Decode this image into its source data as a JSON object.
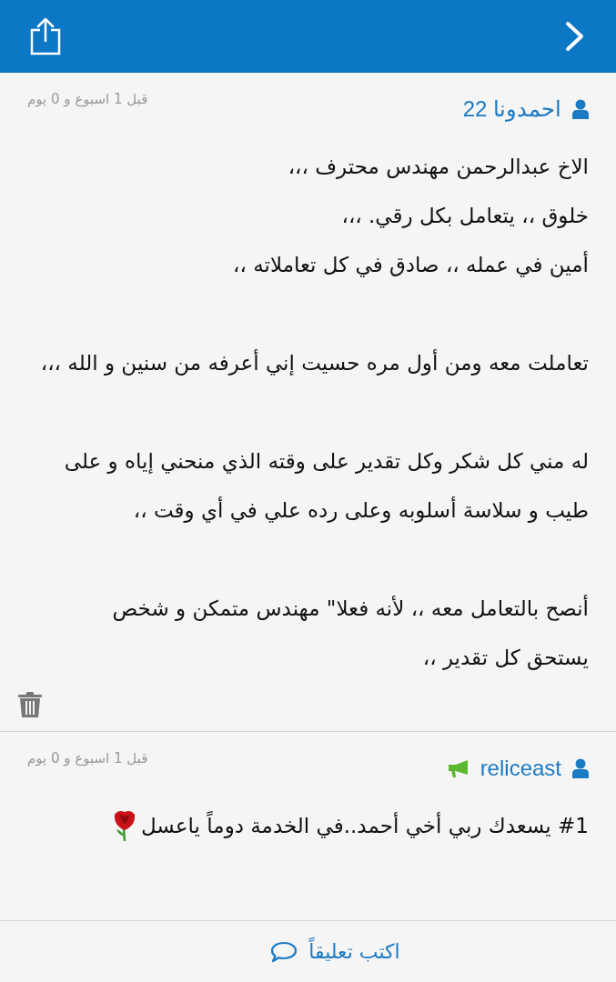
{
  "comments": [
    {
      "author": "احمدونا 22",
      "advertiser": false,
      "time": "قبل 1 اسبوع و 0 يوم",
      "deletable": true,
      "rose": false,
      "paragraphs": [
        [
          "الاخ عبدالرحمن مهندس محترف ،،،",
          "خلوق ،، يتعامل بكل رقي. ،،،",
          "أمين في عمله ،، صادق في كل تعاملاته ،،"
        ],
        [
          "تعاملت معه ومن أول مره حسيت إني أعرفه من سنين و الله ،،،"
        ],
        [
          "له مني كل شكر وكل تقدير على وقته الذي منحني إياه و على",
          "طيب و سلاسة أسلوبه وعلى رده علي في أي وقت ،،"
        ],
        [
          "أنصح بالتعامل معه ،، لأنه فعلا\" مهندس متمكن و شخص",
          "يستحق كل تقدير ،،"
        ]
      ]
    },
    {
      "author": "reliceast",
      "advertiser": true,
      "time": "قبل 1 اسبوع و 0 يوم",
      "deletable": false,
      "rose": true,
      "paragraphs": [
        [
          "#1 يسعدك ربي أخي أحمد..في الخدمة دوماً ياعسل"
        ]
      ]
    }
  ],
  "write_comment": "اكتب تعليقاً"
}
